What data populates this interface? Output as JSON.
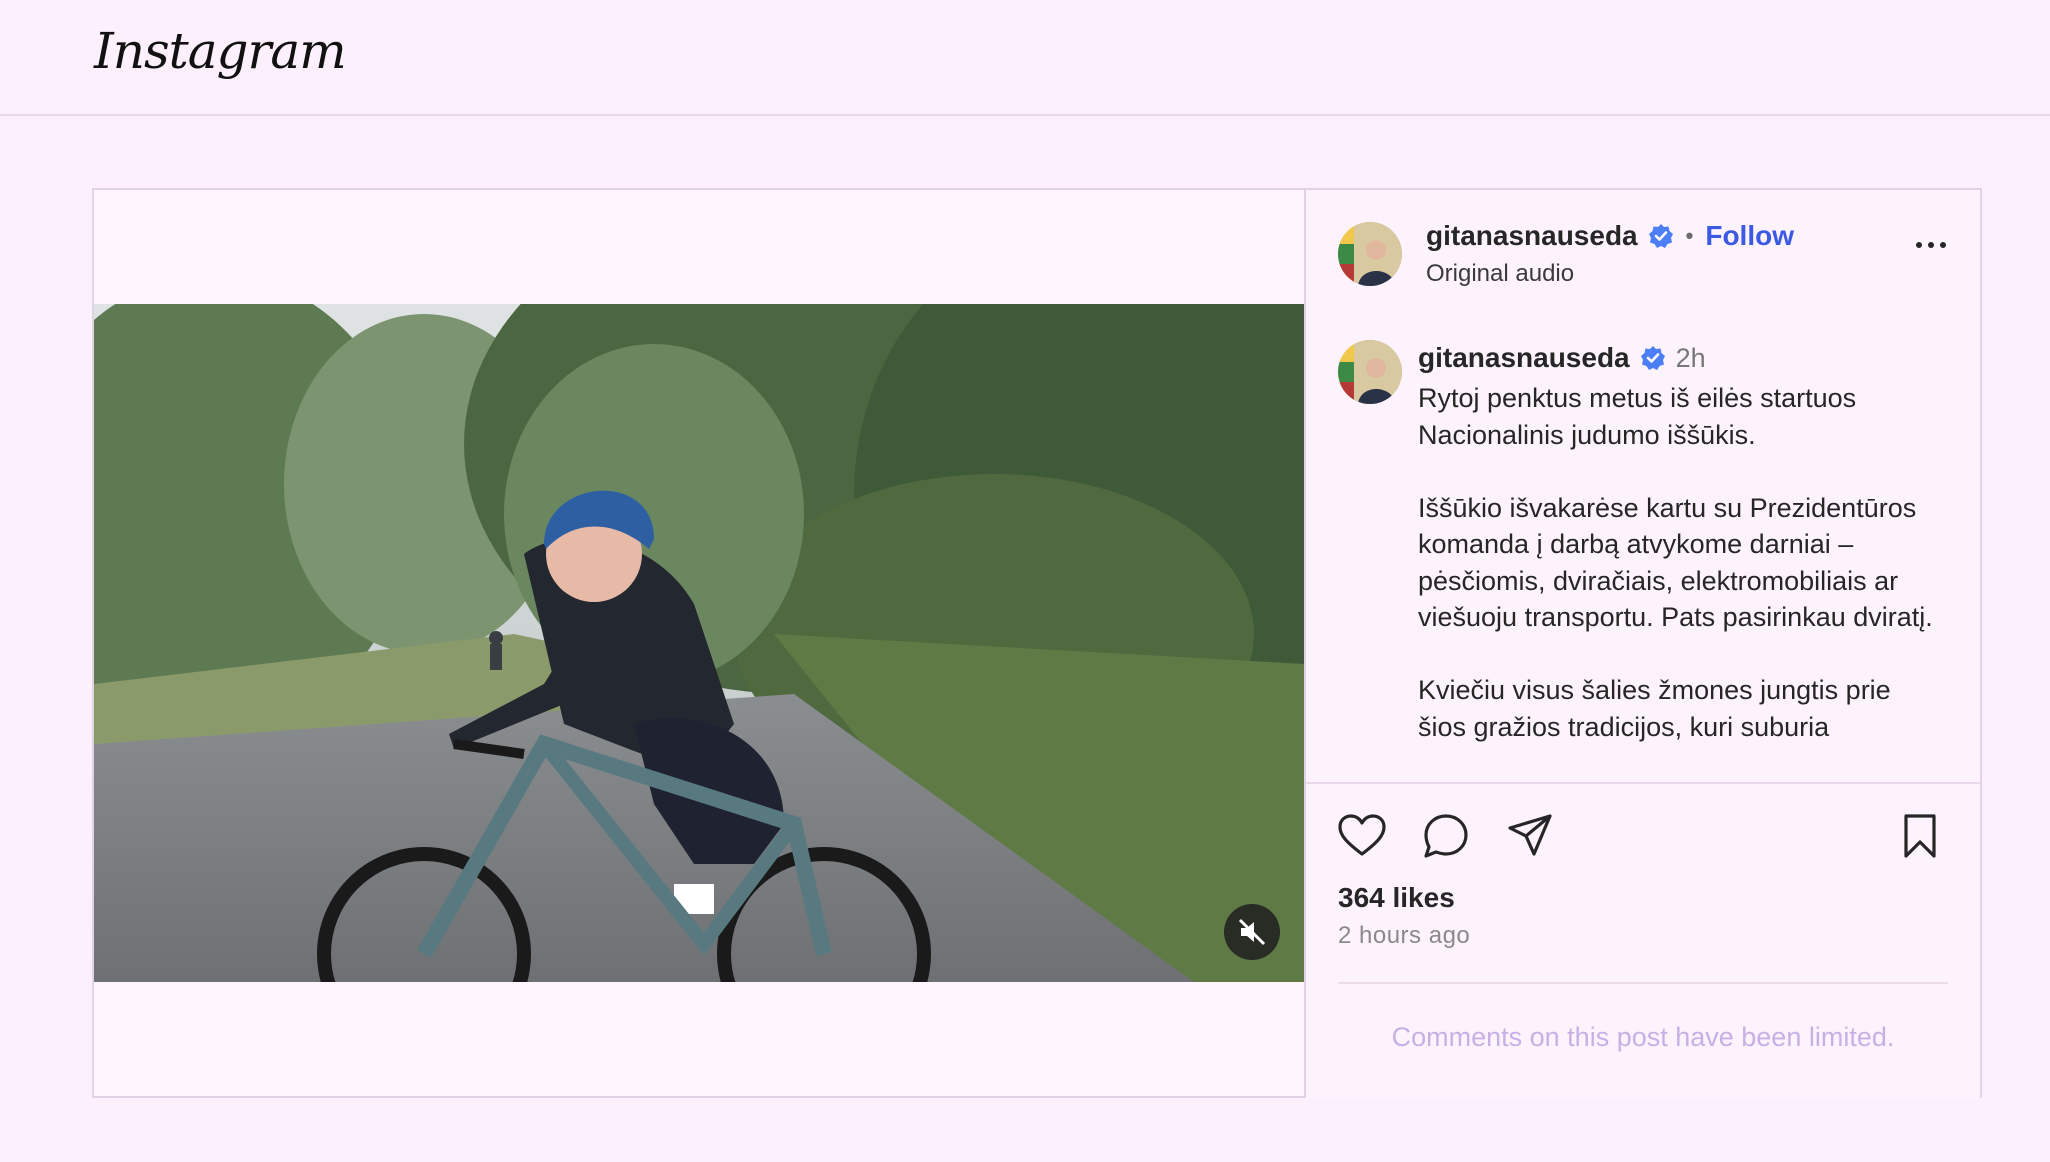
{
  "app": {
    "logo": "Instagram"
  },
  "post": {
    "author": {
      "username": "gitanasnauseda",
      "verified": true,
      "follow_label": "Follow",
      "subtitle": "Original audio"
    },
    "caption": {
      "username": "gitanasnauseda",
      "time": "2h",
      "paragraphs": [
        "Rytoj penktus metus iš eilės startuos Nacionalinis judumo iššūkis.",
        "Iššūkio išvakarėse kartu su Prezidentūros komanda į darbą atvykome darniai – pėsčiomis, dviračiais, elektromobiliais ar viešuoju transportu. Pats pasirinkau dviratį.",
        "Kviečiu visus šalies žmones jungtis prie šios gražios tradicijos, kuri suburia"
      ]
    },
    "likes": "364 likes",
    "posted_ago": "2 hours ago",
    "comments_notice": "Comments on this post have been limited.",
    "icons": {
      "verified": "verified-badge-icon",
      "more": "more-options-icon",
      "like": "heart-icon",
      "comment": "comment-icon",
      "share": "share-icon",
      "save": "bookmark-icon",
      "mute": "muted-speaker-icon"
    },
    "colors": {
      "accent": "#3b5ae3",
      "verified": "#4c7ff5",
      "background": "#fdf0fd"
    }
  }
}
